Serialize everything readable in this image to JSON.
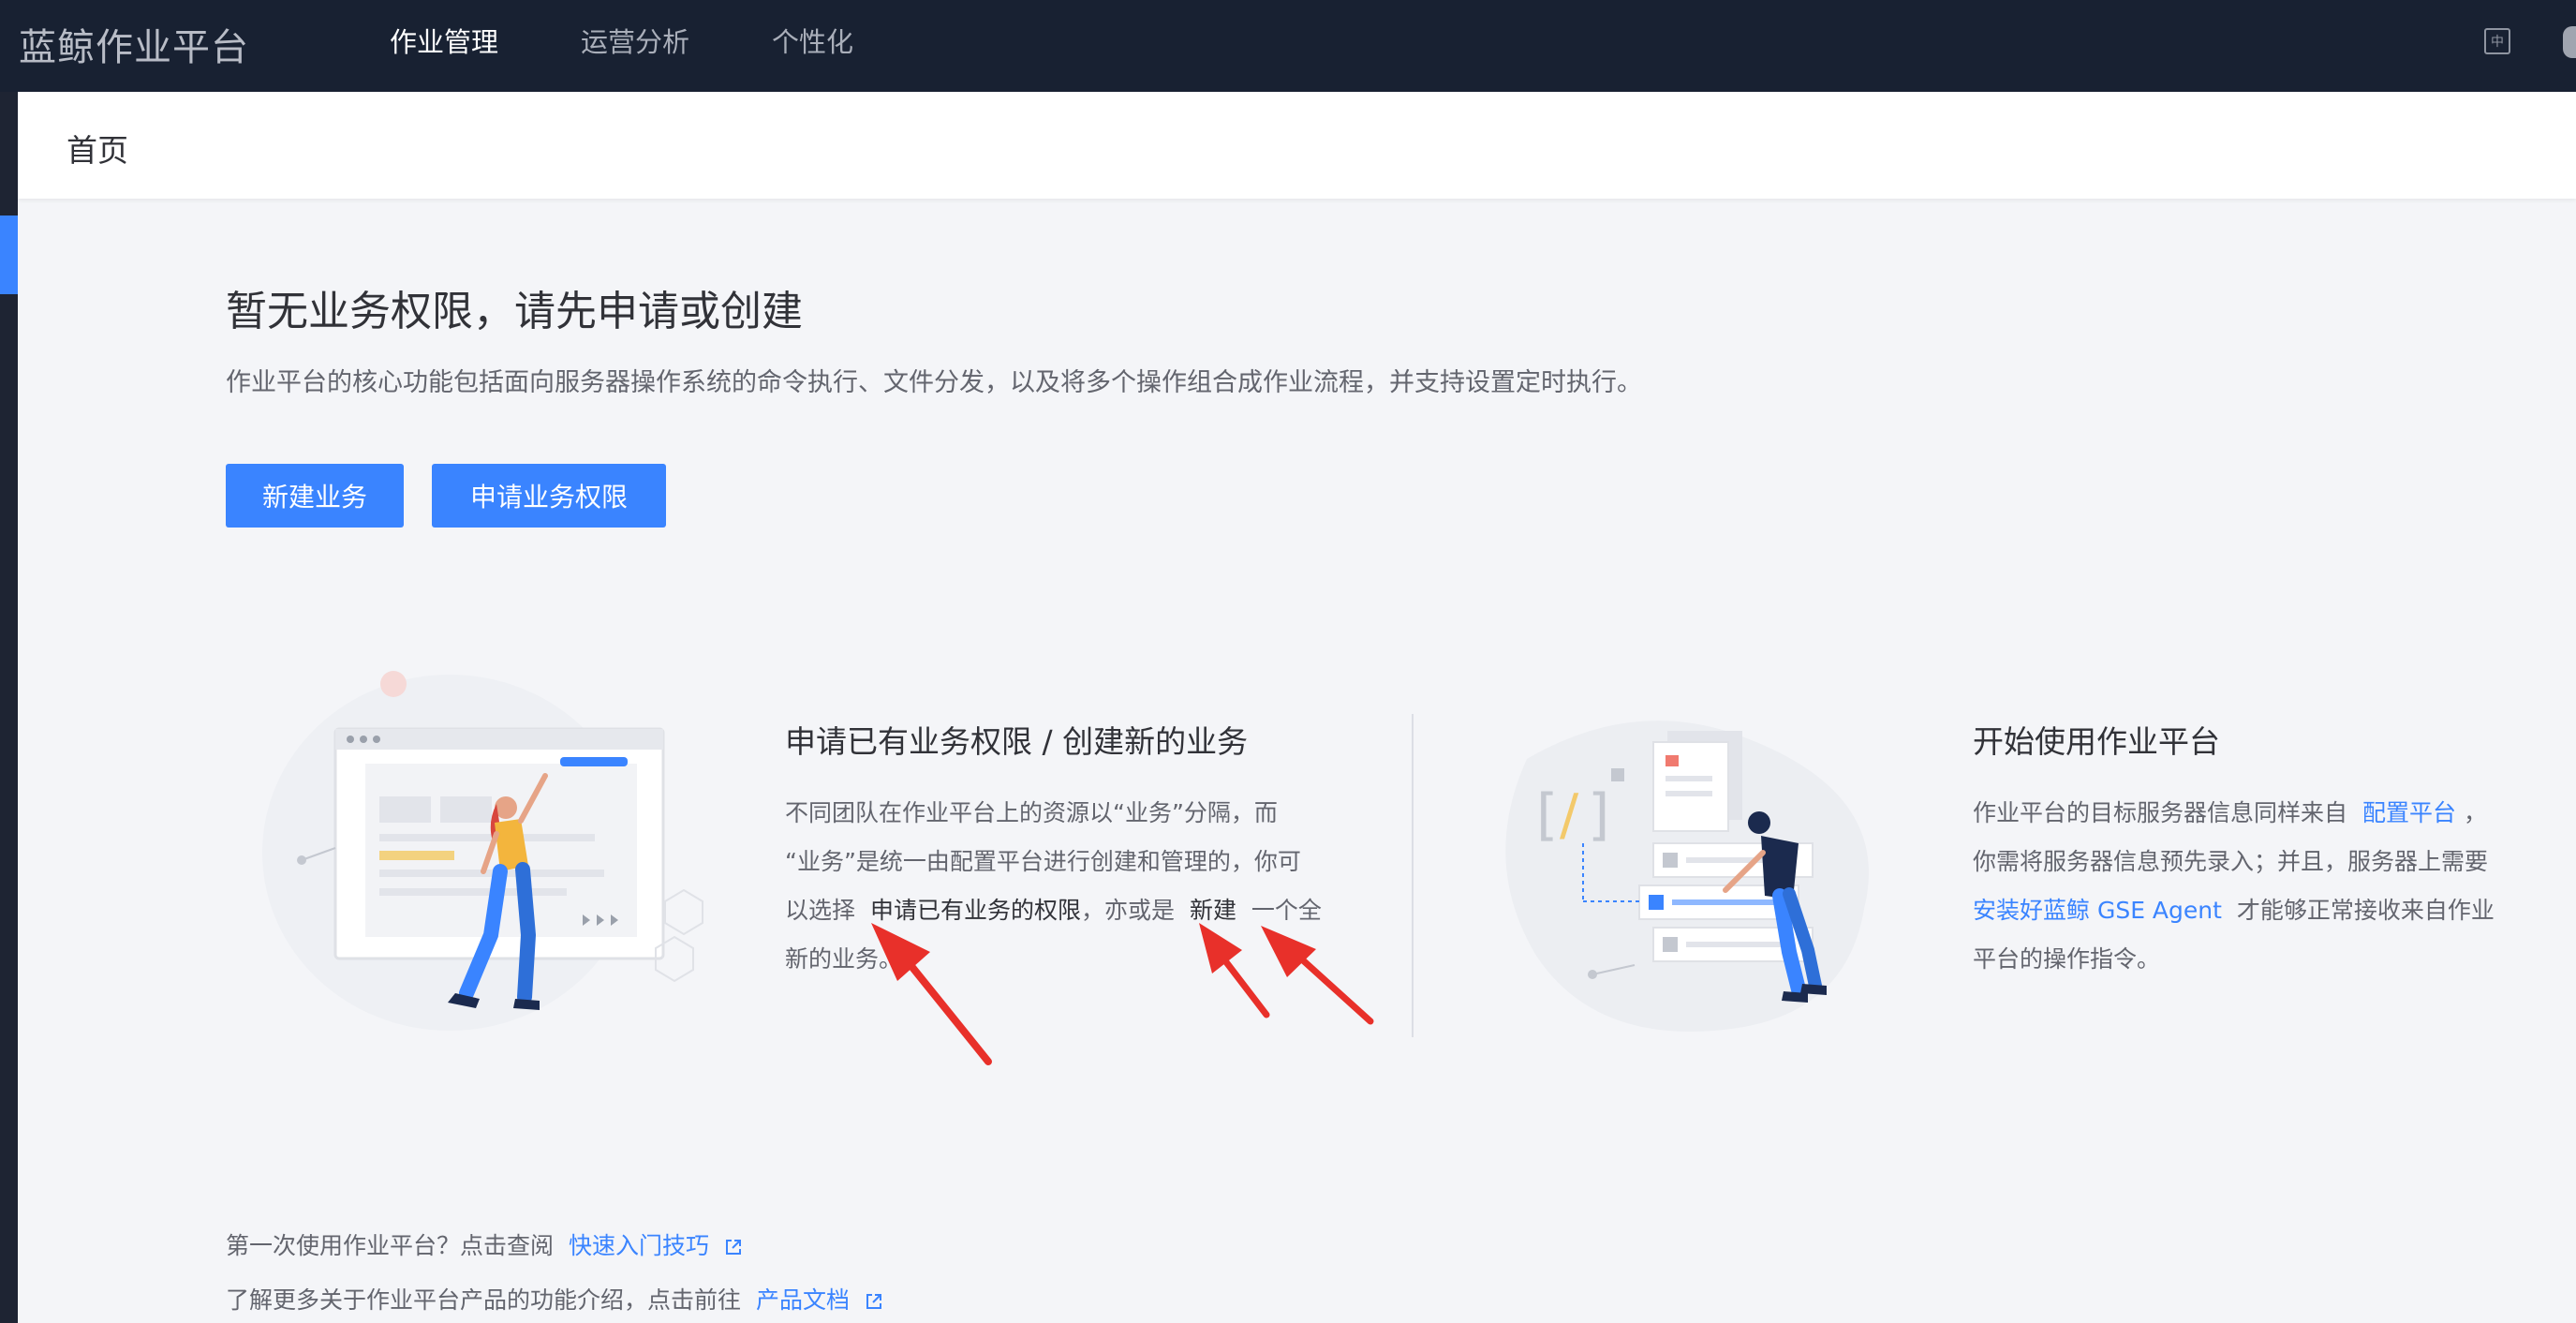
{
  "header": {
    "app_title": "蓝鲸作业平台",
    "nav": [
      {
        "label": "作业管理",
        "active": true
      },
      {
        "label": "运营分析",
        "active": false
      },
      {
        "label": "个性化",
        "active": false
      }
    ]
  },
  "breadcrumb": {
    "title": "首页"
  },
  "main": {
    "headline": "暂无业务权限，请先申请或创建",
    "description": "作业平台的核心功能包括面向服务器操作系统的命令执行、文件分发，以及将多个操作组合成作业流程，并支持设置定时执行。",
    "buttons": {
      "new_business": "新建业务",
      "apply_permission": "申请业务权限"
    }
  },
  "section_left": {
    "title": "申请已有业务权限 / 创建新的业务",
    "line1": "不同团队在作业平台上的资源以“业务”分隔，而",
    "line2": "“业务”是统一由配置平台进行创建和管理的，你可",
    "line3_prefix": "以选择",
    "line3_apply": "申请已有业务的权限",
    "line3_mid": "，亦或是",
    "line3_new": "新建",
    "line3_suffix": "一个全",
    "line4": "新的业务。"
  },
  "section_right": {
    "title": "开始使用作业平台",
    "line1_prefix": "作业平台的目标服务器信息同样来自",
    "line1_link": "配置平台",
    "line1_suffix": "，",
    "line2": "你需将服务器信息预先录入；并且，服务器上需要",
    "line3_link": "安装好蓝鲸 GSE Agent",
    "line3_suffix": "才能够正常接收来自作业",
    "line4": "平台的操作指令。"
  },
  "footer": {
    "line1_text": "第一次使用作业平台？点击查阅",
    "line1_link": "快速入门技巧",
    "line2_text": "了解更多关于作业平台产品的功能介绍，点击前往",
    "line2_link": "产品文档"
  },
  "colors": {
    "accent": "#3a84ff",
    "topbar": "#182132",
    "annotation": "#e8302a"
  }
}
